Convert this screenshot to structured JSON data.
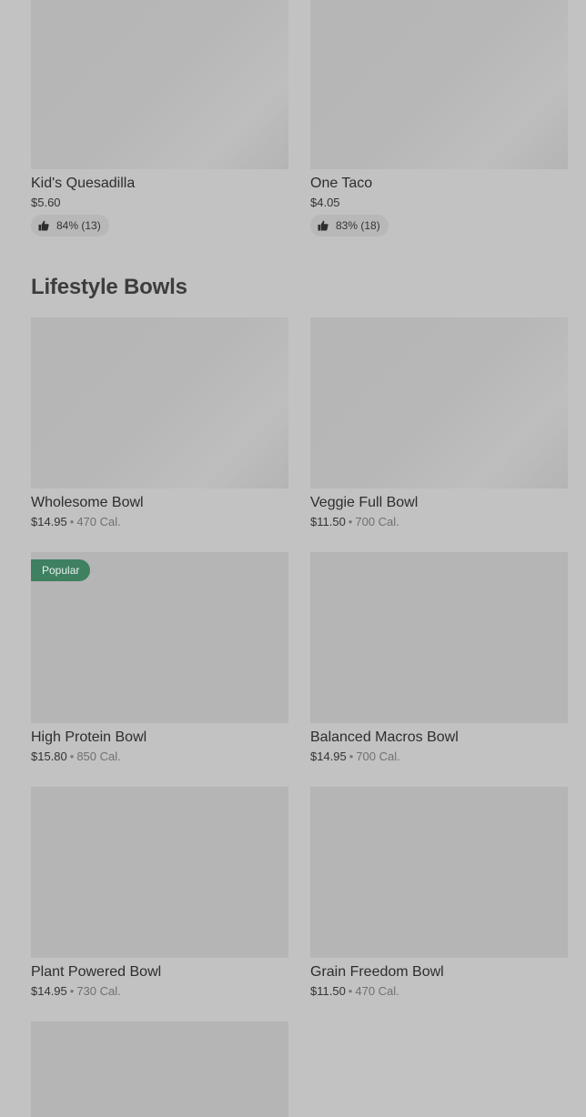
{
  "top_items": [
    {
      "name": "Kid's Quesadilla",
      "price": "$5.60",
      "rating": "84% (13)"
    },
    {
      "name": "One Taco",
      "price": "$4.05",
      "rating": "83% (18)"
    }
  ],
  "section": {
    "title": "Lifestyle Bowls",
    "separator": "•",
    "items": [
      {
        "name": "Wholesome Bowl",
        "price": "$14.95",
        "calories": "470 Cal."
      },
      {
        "name": "Veggie Full Bowl",
        "price": "$11.50",
        "calories": "700 Cal."
      },
      {
        "name": "High Protein Bowl",
        "price": "$15.80",
        "calories": "850 Cal.",
        "badge": "Popular"
      },
      {
        "name": "Balanced Macros Bowl",
        "price": "$14.95",
        "calories": "700 Cal."
      },
      {
        "name": "Plant Powered Bowl",
        "price": "$14.95",
        "calories": "730 Cal."
      },
      {
        "name": "Grain Freedom Bowl",
        "price": "$11.50",
        "calories": "470 Cal."
      }
    ]
  },
  "colors": {
    "background": "#c2c2c2",
    "badge": "#3e8060",
    "image_placeholder": "#b5b5b5"
  },
  "icons": {
    "rating": "thumbs-up-icon"
  }
}
